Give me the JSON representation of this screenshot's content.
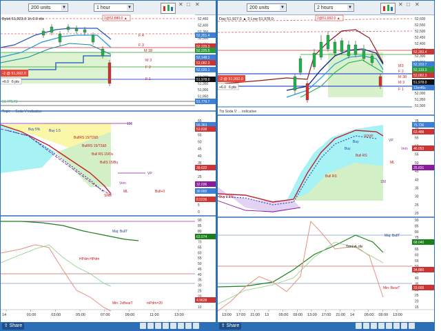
{
  "left": {
    "units_select": "200 units",
    "timeframe_select": "1 hour",
    "header_text": "2@52,880.0 ▲",
    "info_text": "Bybit 51,823.0 1h 0.0 dts",
    "y_ticks_top": [
      "52,450",
      "52,400",
      "52,350",
      "52,300",
      "52,250",
      "52,200",
      "52,150",
      "52,100",
      "52,050",
      "52,000",
      "51,950",
      "51,900",
      "51,850",
      "51,800"
    ],
    "price_boxes": [
      "52,351.4",
      "52,229.3",
      "52,225.5",
      "52,148.1",
      "52,082.3",
      "52,020.1",
      "51,978.0",
      "51,779.7"
    ],
    "level_labels": [
      "F 4",
      "F 3",
      "M 38",
      "F 2",
      "F 1",
      "M 3"
    ],
    "order_label": "-2 @ 51,992.0",
    "order_small": "+6.0",
    "pts": "6 pts",
    "bottom_left_value": "51,779.73",
    "indicator_label": "Triple ... Soda V indicative",
    "mid_ticks": [
      "65",
      "60",
      "55",
      "50",
      "45",
      "40",
      "35",
      "30",
      "25",
      "20",
      "15",
      "10",
      "5",
      "0"
    ],
    "mid_boxes": [
      "55.363",
      "53.838",
      "39.622",
      "32.036",
      "30.000",
      "8.0226"
    ],
    "mid_labels": [
      "Buy 5%",
      "Buy 1.5",
      "BullRS 15/T2&5",
      "BullRS 15/T2&5",
      "Bull RS 15/Ds",
      "BullS 15/Bu",
      "Vein",
      "ML",
      "Bull+0",
      "ShEr",
      "VP",
      "150"
    ],
    "low_ticks": [
      "90",
      "85",
      "80",
      "75",
      "70",
      "65",
      "60",
      "55",
      "50",
      "45",
      "40",
      "35",
      "30",
      "25",
      "20",
      "15",
      "10"
    ],
    "low_boxes": [
      "63.074",
      "4.9628"
    ],
    "low_labels": [
      "Maj: BullT",
      "HPdm HPdm",
      "Min: 2xBearT",
      "mPdm=20"
    ],
    "time_labels": [
      "14",
      "01:00",
      "03:00",
      "05:00",
      "07:00",
      "09:00",
      "11:00",
      "13:00"
    ]
  },
  "right": {
    "units_select": "200 units",
    "timeframe_select": "2 hours",
    "header_text": "2@51,992.0 ▲",
    "info_text": "Day 51,927.0 ▲ 3 Low 51,978.0",
    "y_ticks_top": [
      "52,600",
      "52,550",
      "52,500",
      "52,450",
      "52,400",
      "52,350",
      "52,300",
      "52,250",
      "52,200",
      "52,150",
      "52,100",
      "52,050",
      "52,000",
      "51,950",
      "51,900"
    ],
    "price_boxes": [
      "52,283.4",
      "52,153.7",
      "52,133.3",
      "52,082.3",
      "51,978.0",
      "13m46s"
    ],
    "level_labels": [
      "M3",
      "F 2",
      "M 38",
      "F 1",
      "M 3"
    ],
    "order_label": "-2 @ 51,992.0",
    "order_small": "+6.0",
    "pts": "6 pts",
    "indicator_label": "Trp Soda V: ... indicative",
    "mid_ticks": [
      "75",
      "70",
      "65",
      "60",
      "55",
      "50",
      "45",
      "40",
      "35",
      "30",
      "25",
      "20"
    ],
    "mid_boxes": [
      "75.736",
      "63.488",
      "46.053",
      "25.831"
    ],
    "mid_labels": [
      "SDVP",
      "Buy",
      "Buy",
      "Bull RS",
      "Bull RS",
      "Buy 1.5%",
      "Vein",
      "ML",
      "150",
      "VP"
    ],
    "low_ticks": [
      "90",
      "85",
      "80",
      "75",
      "70",
      "65",
      "60",
      "55",
      "50",
      "45",
      "40",
      "35",
      "30",
      "25",
      "20",
      "15"
    ],
    "low_boxes": [
      "68.040",
      "34.880",
      "33.665"
    ],
    "low_labels": [
      "Maj: BullT",
      "TrmLvL div",
      "Min: BearT"
    ],
    "time_labels": [
      "13:00",
      "17:00",
      "21:00",
      "13",
      "05:00",
      "09:00",
      "13:00",
      "17:00",
      "21:00",
      "14",
      "05:00",
      "09:00",
      "13:00"
    ]
  },
  "colors": {
    "accent": "#2d6fb6",
    "candle_up": "#22b14c",
    "candle_down": "#d32f2f",
    "macd_green": "#1a7f1a",
    "cyan_fill": "#9ff3f6",
    "yellow_fill": "#fbf7a8",
    "green_fill": "#cdeec2"
  }
}
